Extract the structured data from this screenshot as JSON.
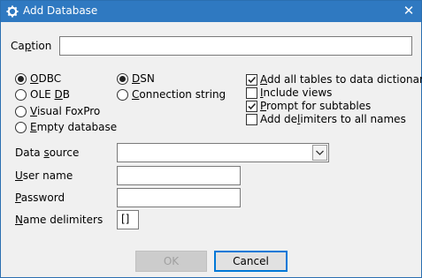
{
  "window": {
    "title": "Add Database",
    "close_glyph": "✕"
  },
  "caption": {
    "label_pre": "Ca",
    "label_u": "p",
    "label_post": "tion",
    "value": ""
  },
  "source_type": {
    "selected": "ODBC",
    "options": [
      {
        "pre": "",
        "u": "O",
        "post": "DBC"
      },
      {
        "pre": "OLE ",
        "u": "D",
        "post": "B"
      },
      {
        "pre": "",
        "u": "V",
        "post": "isual FoxPro"
      },
      {
        "pre": "",
        "u": "E",
        "post": "mpty database"
      }
    ]
  },
  "connection_type": {
    "selected": "DSN",
    "options": [
      {
        "pre": "",
        "u": "D",
        "post": "SN"
      },
      {
        "pre": "",
        "u": "C",
        "post": "onnection string"
      }
    ]
  },
  "options": [
    {
      "pre": "",
      "u": "A",
      "post": "dd all tables to data dictionary",
      "checked": true
    },
    {
      "pre": "",
      "u": "I",
      "post": "nclude views",
      "checked": false
    },
    {
      "pre": "",
      "u": "P",
      "post": "rompt for subtables",
      "checked": true
    },
    {
      "pre": "Add de",
      "u": "l",
      "post": "imiters to all names",
      "checked": false
    }
  ],
  "fields": {
    "data_source": {
      "pre": "Data ",
      "u": "s",
      "post": "ource",
      "value": ""
    },
    "user_name": {
      "pre": "",
      "u": "U",
      "post": "ser name",
      "value": ""
    },
    "password": {
      "pre": "",
      "u": "P",
      "post": "assword",
      "value": ""
    },
    "name_delimiters": {
      "pre": "",
      "u": "N",
      "post": "ame delimiters",
      "value": "[]"
    }
  },
  "buttons": {
    "ok": "OK",
    "cancel": "Cancel"
  },
  "colors": {
    "titlebar": "#2f79c1",
    "focus_border": "#0078d7"
  }
}
